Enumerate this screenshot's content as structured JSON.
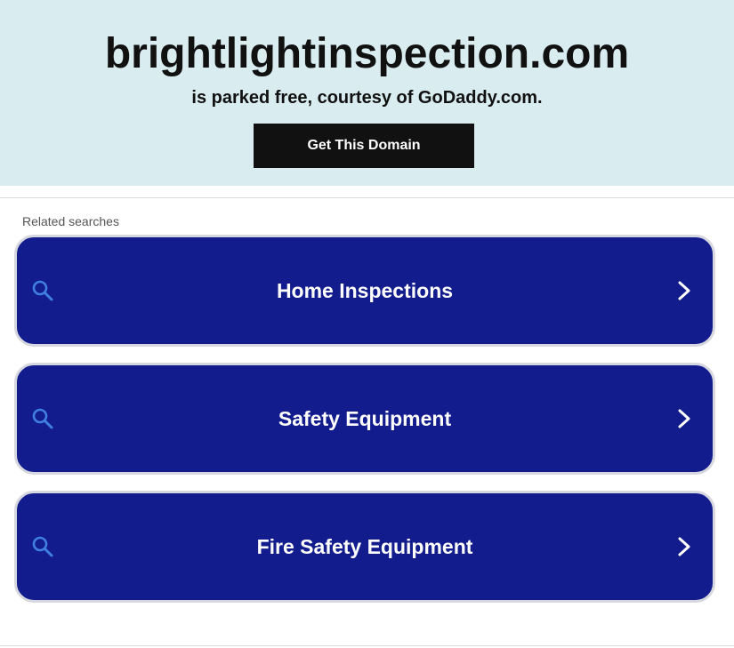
{
  "banner": {
    "domain": "brightlightinspection.com",
    "subtitle": "is parked free, courtesy of GoDaddy.com.",
    "cta_label": "Get This Domain",
    "background_color": "#d9ecef"
  },
  "related": {
    "label": "Related searches",
    "items": [
      {
        "label": "Home Inspections",
        "left_icon": "search-icon",
        "right_icon": "chevron-right-icon"
      },
      {
        "label": "Safety Equipment",
        "left_icon": "search-icon",
        "right_icon": "chevron-right-icon"
      },
      {
        "label": "Fire Safety Equipment",
        "left_icon": "search-icon",
        "right_icon": "chevron-right-icon"
      }
    ],
    "item_color": "#121c8c",
    "icon_color": "#3f7fe0"
  }
}
